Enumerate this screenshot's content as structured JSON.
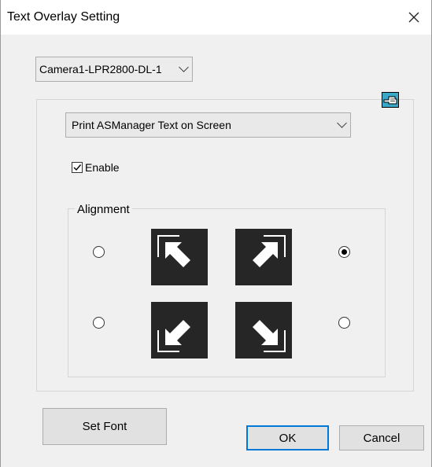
{
  "window": {
    "title": "Text Overlay Setting"
  },
  "camera_select": {
    "value": "Camera1-LPR2800-DL-1"
  },
  "overlay_mode_select": {
    "value": "Print ASManager Text on Screen"
  },
  "enable_checkbox": {
    "label": "Enable",
    "checked": true
  },
  "alignment": {
    "label": "Alignment",
    "selected": "top-right",
    "options": [
      "top-left",
      "top-right",
      "bottom-left",
      "bottom-right"
    ]
  },
  "buttons": {
    "set_font": "Set Font",
    "ok": "OK",
    "cancel": "Cancel"
  },
  "icons": {
    "close": "close-icon",
    "pin": "pointing-hand-icon",
    "chevron": "chevron-down-icon",
    "align_top_left": "arrow-top-left-icon",
    "align_top_right": "arrow-top-right-icon",
    "align_bottom_left": "arrow-bottom-left-icon",
    "align_bottom_right": "arrow-bottom-right-icon"
  },
  "colors": {
    "accent": "#0078d7",
    "dialog_bg": "#f0f0f0",
    "arrow_tile": "#262626"
  }
}
